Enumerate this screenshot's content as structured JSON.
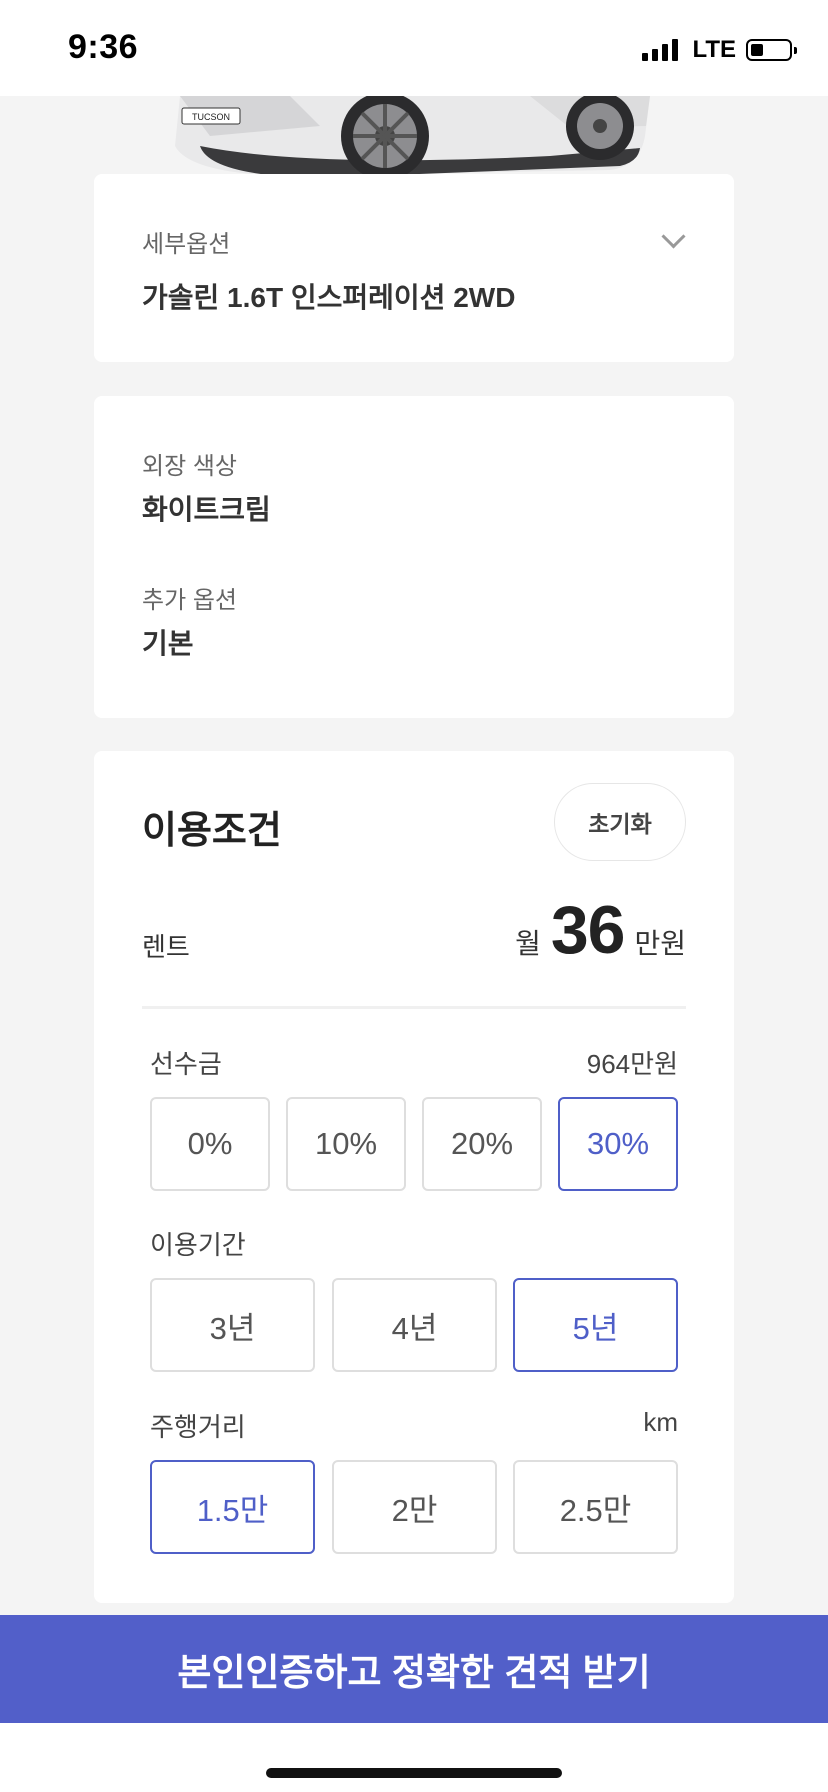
{
  "status": {
    "time": "9:36",
    "network": "LTE"
  },
  "car": {
    "plate": "TUCSON"
  },
  "trim": {
    "label": "세부옵션",
    "value": "가솔린 1.6T 인스퍼레이션 2WD"
  },
  "exterior": {
    "label": "외장 색상",
    "value": "화이트크림"
  },
  "extra": {
    "label": "추가 옵션",
    "value": "기본"
  },
  "terms": {
    "title": "이용조건",
    "reset_label": "초기화",
    "rent_label": "렌트",
    "price_prefix": "월",
    "price_value": "36",
    "price_unit": "만원",
    "deposit": {
      "label": "선수금",
      "amount": "964만원",
      "options": [
        "0%",
        "10%",
        "20%",
        "30%"
      ],
      "selected": "30%"
    },
    "period": {
      "label": "이용기간",
      "options": [
        "3년",
        "4년",
        "5년"
      ],
      "selected": "5년"
    },
    "mileage": {
      "label": "주행거리",
      "unit": "km",
      "options": [
        "1.5만",
        "2만",
        "2.5만"
      ],
      "selected": "1.5만"
    }
  },
  "cta": {
    "label": "본인인증하고 정확한 견적 받기"
  },
  "colors": {
    "accent": "#4f5fc8",
    "cta_bg": "#525fc9",
    "page_bg": "#f4f4f4"
  }
}
